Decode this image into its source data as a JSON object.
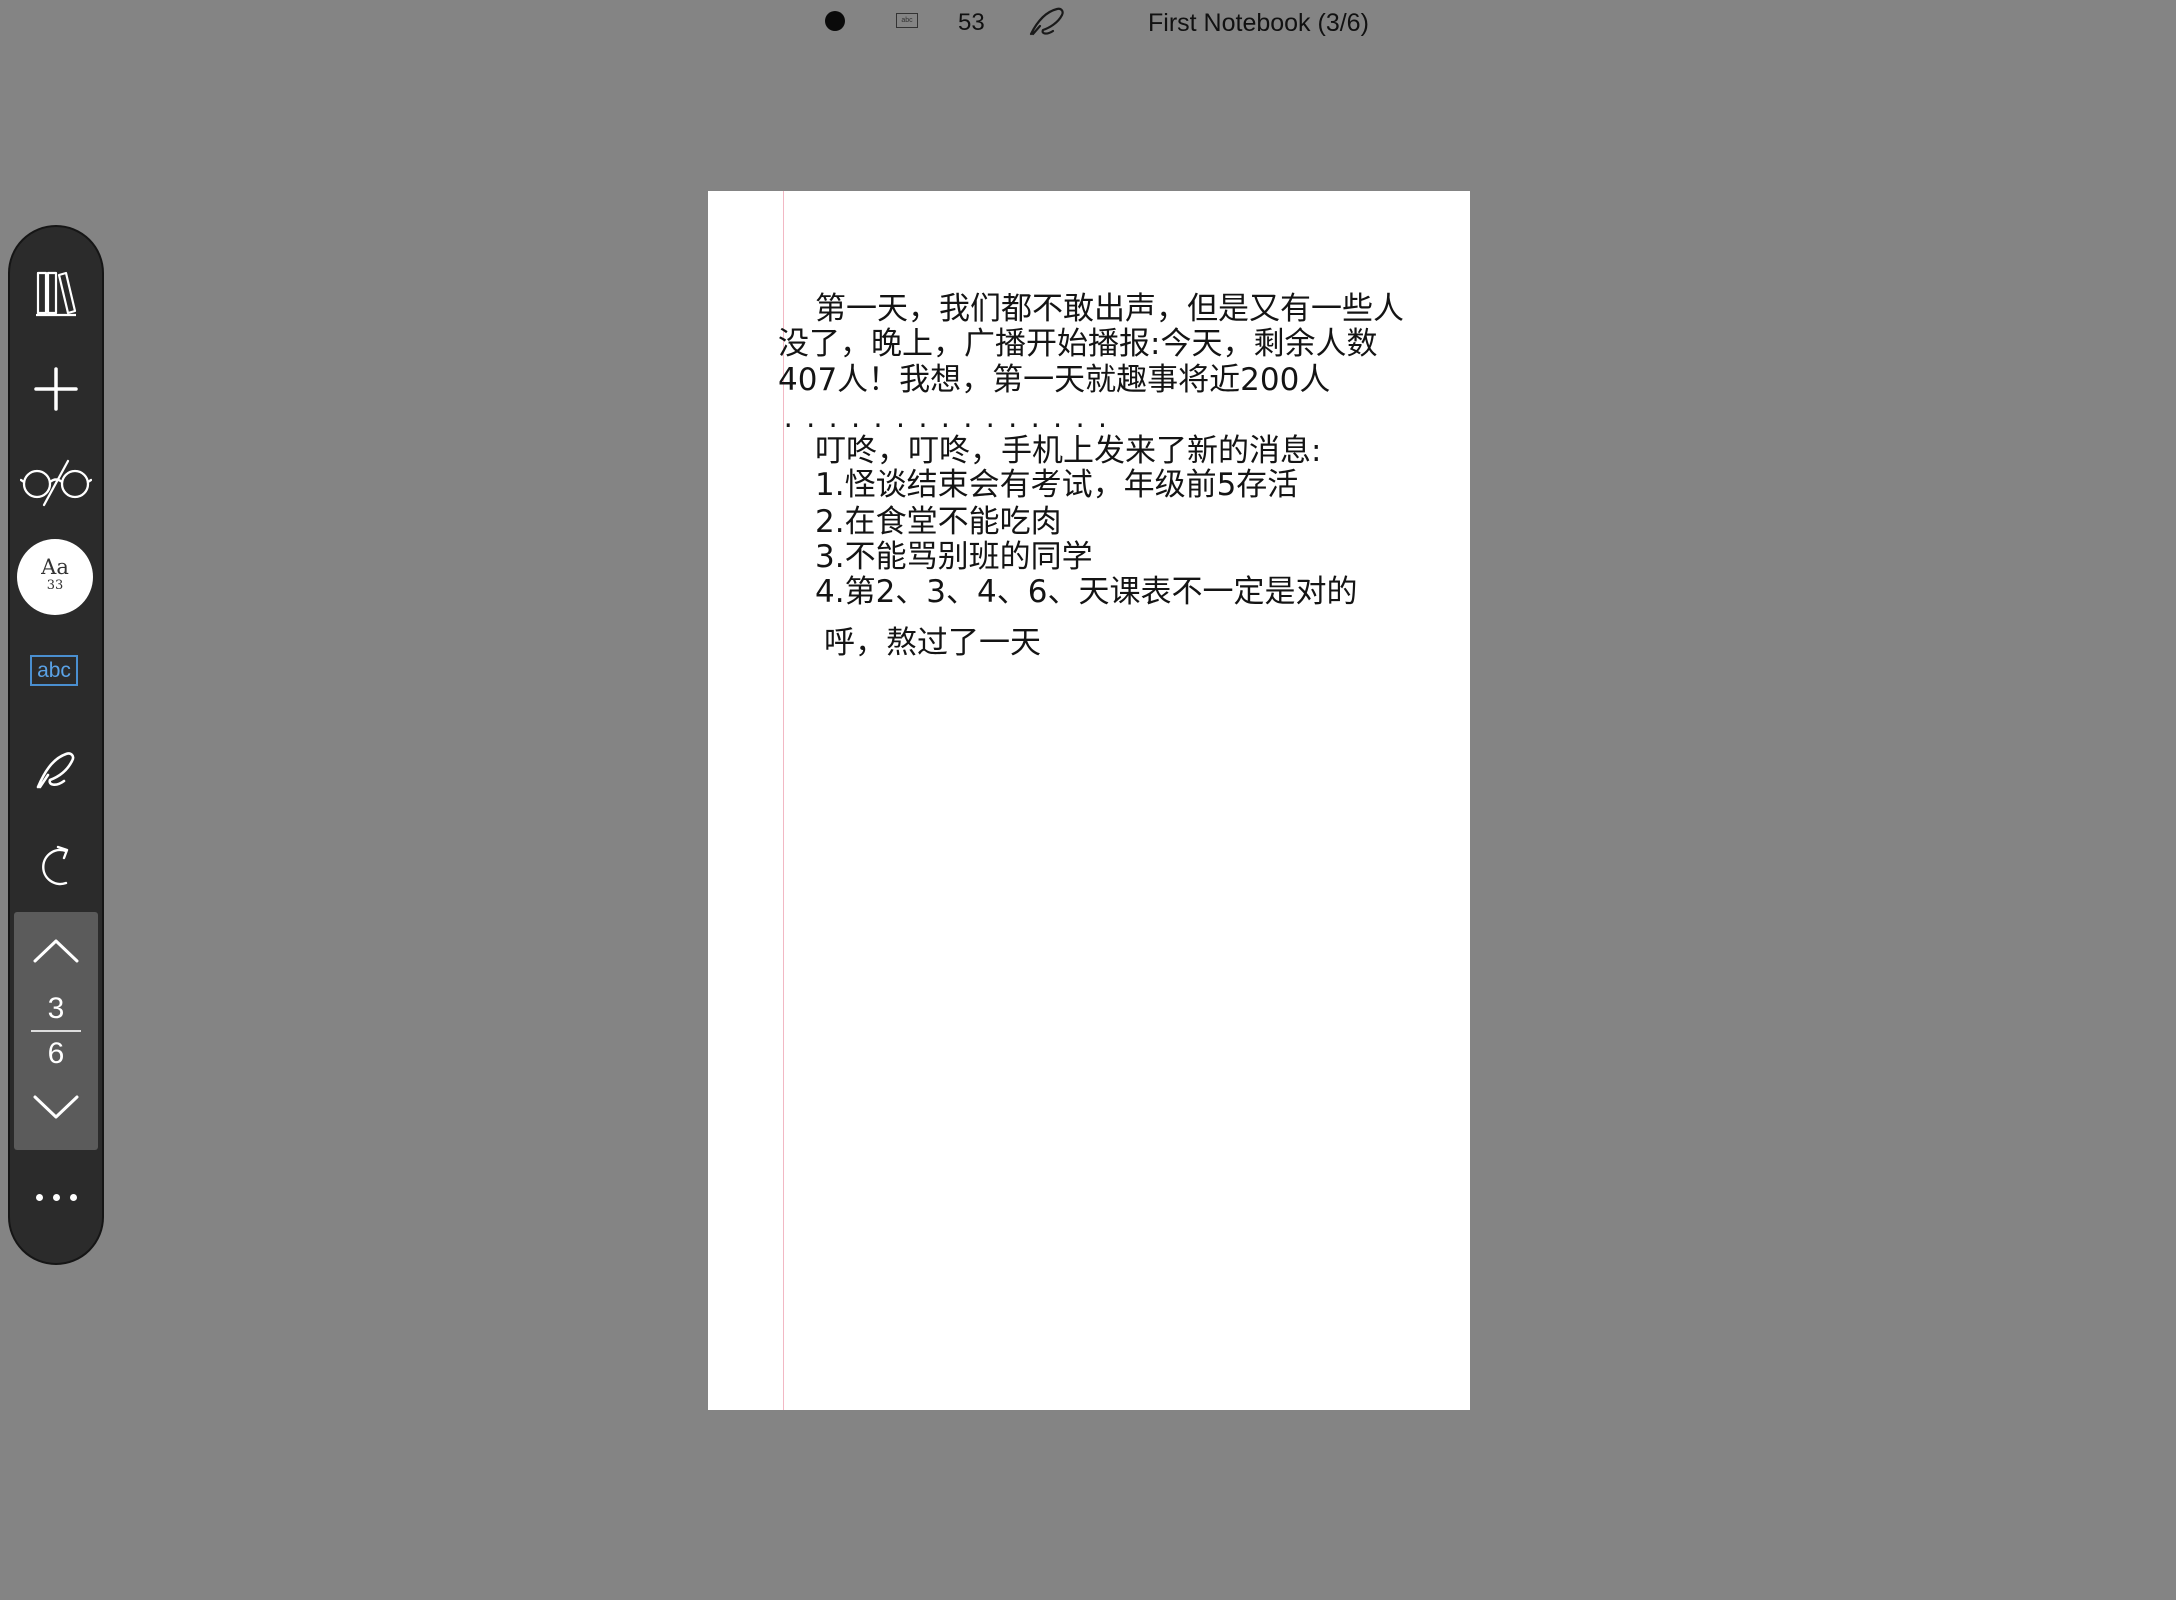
{
  "status_bar": {
    "stroke_count": "53",
    "notebook_title": "First Notebook (3/6)",
    "icons": [
      "brush-dot-icon",
      "abc-mini-icon",
      "pen-icon"
    ]
  },
  "toolbar": {
    "icons": [
      "library-icon",
      "add-icon",
      "glasses-icon",
      "font-size-button",
      "abc-button",
      "pen-icon",
      "redo-icon",
      "page-up-icon",
      "page-down-icon",
      "more-icon"
    ],
    "font_button": {
      "label": "Aa",
      "size": "33"
    },
    "abc_label": "abc",
    "accent_color": "#5aa2e6",
    "pager": {
      "current": "3",
      "total": "6"
    }
  },
  "note": {
    "lines": [
      "第一天，我们都不敢出声，但是又有一些人",
      "没了，晚上，广播开始播报:今天，剩余人数",
      "407人！我想，第一天就趣事将近200人",
      "叮咚，叮咚，手机上发来了新的消息:",
      "1.怪谈结束会有考试，年级前5存活",
      "2.在食堂不能吃肉",
      "3.不能骂别班的同学",
      "4.第2、3、4、6、天课表不一定是对的",
      "呼，熬过了一天"
    ],
    "dots": "..............."
  }
}
